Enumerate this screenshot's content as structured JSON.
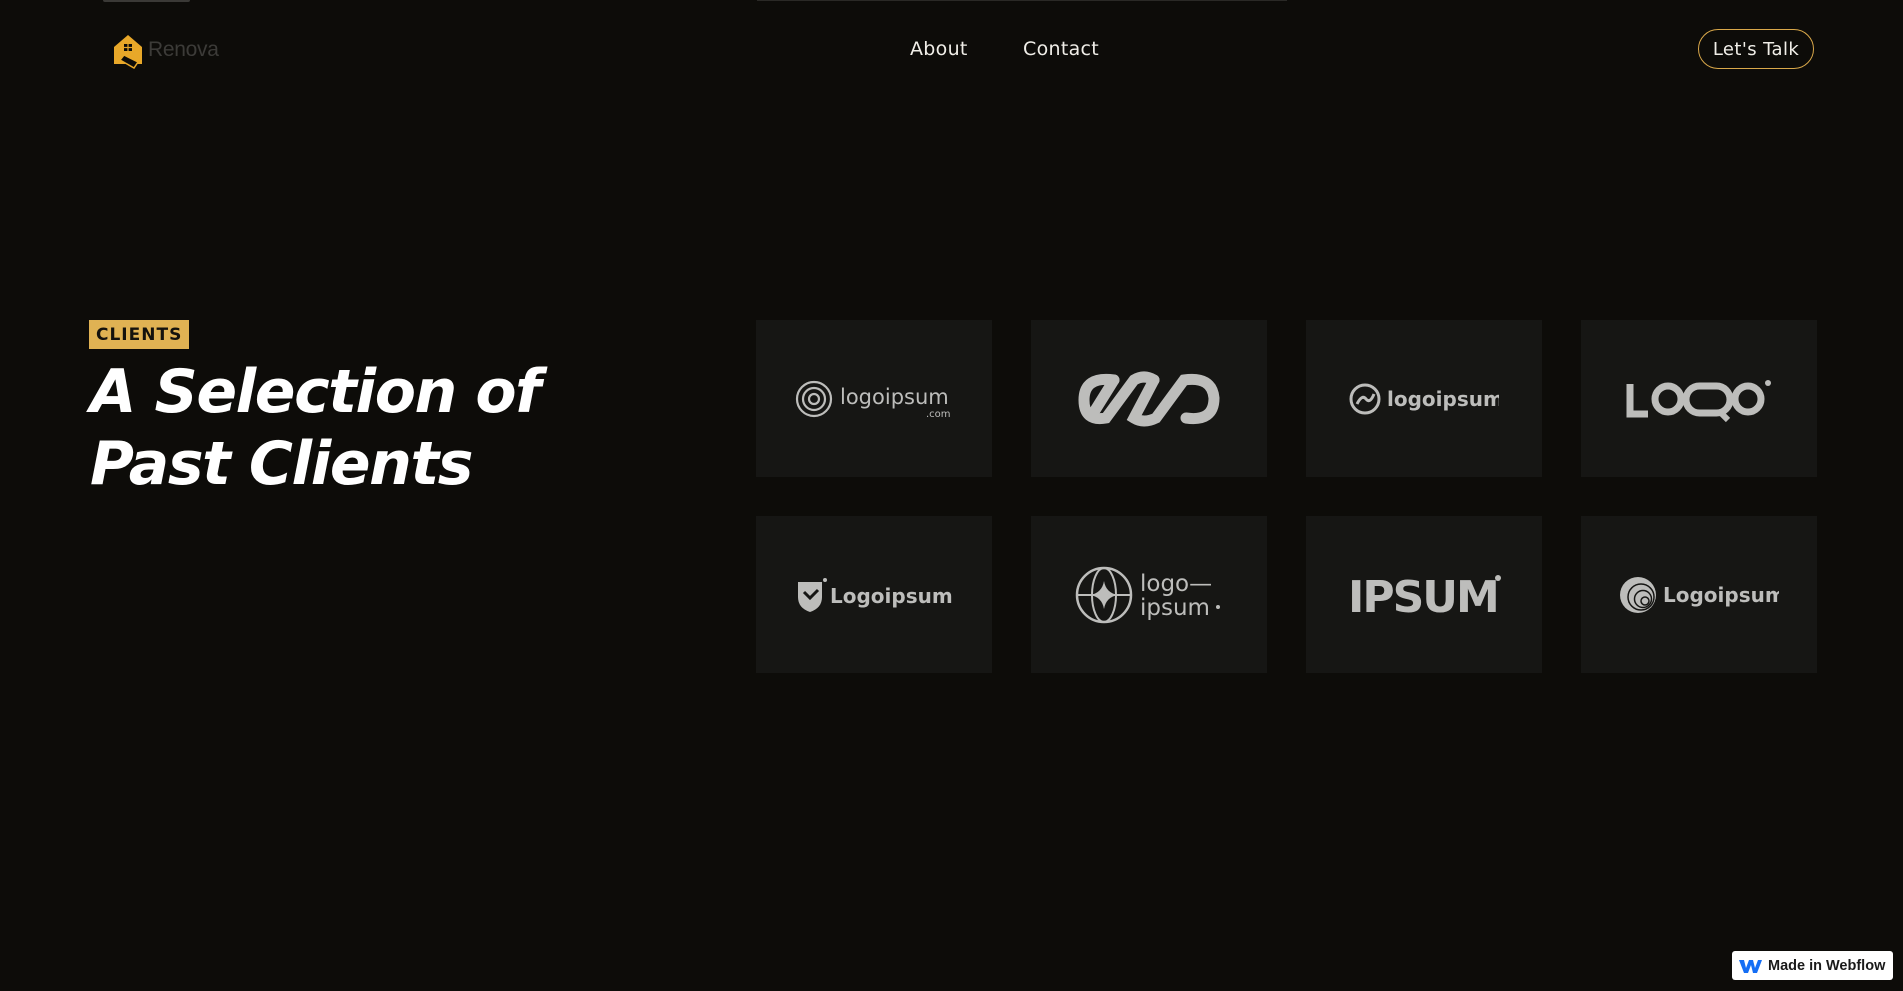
{
  "brand": {
    "name": "Renova",
    "accent": "#e0b253",
    "background": "#0d0c09",
    "tile_bg": "#161614"
  },
  "nav": {
    "logo_text": "Renova",
    "links": [
      {
        "label": "About"
      },
      {
        "label": "Contact"
      }
    ],
    "cta_label": "Let's Talk"
  },
  "hero": {
    "badge": "CLIENTS",
    "headline": "A Selection of Past Clients"
  },
  "clients": [
    {
      "icon": "spiral-circle-icon",
      "name": "logoipsum",
      "sub": ".com"
    },
    {
      "icon": "chain-links-icon",
      "name": ""
    },
    {
      "icon": "wave-circle-icon",
      "name": "logoipsum"
    },
    {
      "icon": "looo-wordmark-icon",
      "name": "LOQO"
    },
    {
      "icon": "shield-icon",
      "name": "Logoipsum"
    },
    {
      "icon": "globe-star-icon",
      "name": "logo—ipsum"
    },
    {
      "icon": "ipsum-wordmark-icon",
      "name": "IPSUM"
    },
    {
      "icon": "ripple-circle-icon",
      "name": "Logoipsum"
    }
  ],
  "webflow_badge": {
    "label": "Made in Webflow",
    "icon": "webflow-w-icon"
  }
}
